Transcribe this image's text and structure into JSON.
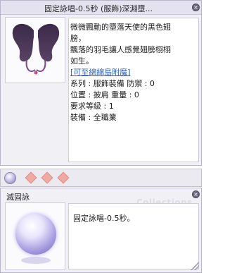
{
  "item_window": {
    "title": "固定詠唱-0.5秒 (服飾)深淵墮...",
    "close": "×",
    "description": {
      "line1": "微微飄動的墮落天使的黑色翅",
      "line2": "膀，",
      "line3": "飄落的羽毛讓人感覺翅膀栩栩",
      "line4": "如生。",
      "link": "[可至綿綿島附魔]",
      "type_row": "系列 : 服飾裝備 防禦 : 0",
      "location_row": "位置 : 披肩 重量 : 0",
      "level_row": "要求等級 : 1",
      "equip_row": "裝備 : 全職業"
    },
    "image_icon": "dark-angel-wings-icon"
  },
  "strip": {
    "orb_icon": "enchant-orb-icon",
    "diamond_icon": "pink-diamond-icon",
    "diamond_count": 3
  },
  "enchant_window": {
    "title": "滅固詠",
    "close": "×",
    "effect": "固定詠唱-0.5秒。",
    "watermark": "Collections",
    "image_icon": "enchant-orb-icon"
  }
}
